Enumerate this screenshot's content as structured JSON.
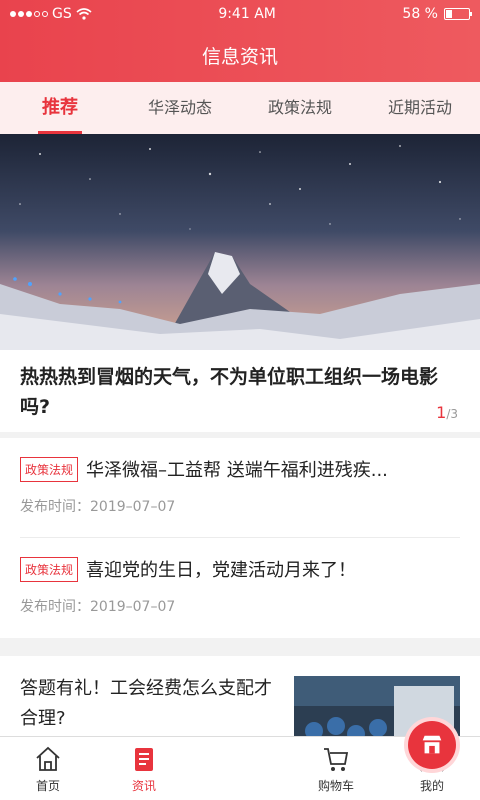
{
  "status_bar": {
    "carrier": "GS",
    "time": "9:41 AM",
    "battery": "58 %",
    "battery_level_percent": 58
  },
  "header": {
    "title": "信息资讯"
  },
  "tabs": [
    {
      "label": "推荐",
      "active": true
    },
    {
      "label": "华泽动态",
      "active": false
    },
    {
      "label": "政策法规",
      "active": false
    },
    {
      "label": "近期活动",
      "active": false
    }
  ],
  "carousel": {
    "caption": "热热热到冒烟的天气，不为单位职工组织一场电影吗?",
    "page_current": "1",
    "page_total": "/3"
  },
  "news": [
    {
      "tag": "政策法规",
      "title": "华泽微福–工益帮 送端午福利进残疾...",
      "date": "发布时间：2019–07–07"
    },
    {
      "tag": "政策法规",
      "title": "喜迎党的生日，党建活动月来了！",
      "date": "发布时间：2019–07–07"
    }
  ],
  "feature": {
    "title": "答题有礼！工会经费怎么支配才合理?"
  },
  "tabbar": [
    {
      "label": "首页",
      "icon": "home-icon",
      "active": false
    },
    {
      "label": "资讯",
      "icon": "news-icon",
      "active": true
    },
    {
      "label": "",
      "icon": "store-icon",
      "active": false
    },
    {
      "label": "购物车",
      "icon": "cart-icon",
      "active": false
    },
    {
      "label": "我的",
      "icon": "user-icon",
      "active": false
    }
  ],
  "colors": {
    "accent": "#e8343d",
    "tab_bg": "#fdeeee"
  }
}
